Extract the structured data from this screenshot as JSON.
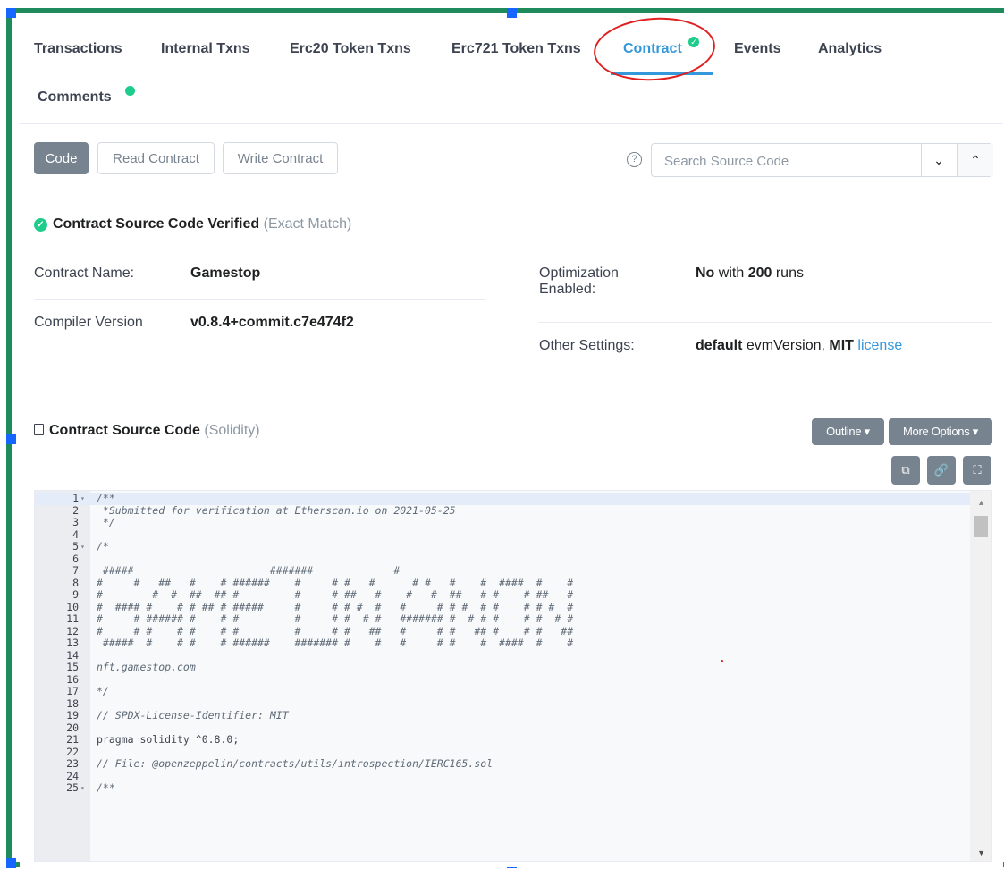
{
  "tabs": [
    {
      "label": "Transactions"
    },
    {
      "label": "Internal Txns"
    },
    {
      "label": "Erc20 Token Txns"
    },
    {
      "label": "Erc721 Token Txns"
    },
    {
      "label": "Contract"
    },
    {
      "label": "Events"
    },
    {
      "label": "Analytics"
    },
    {
      "label": "Comments"
    }
  ],
  "code_tabs": {
    "code": "Code",
    "read": "Read Contract",
    "write": "Write Contract"
  },
  "search": {
    "placeholder": "Search Source Code"
  },
  "verified": {
    "title": "Contract Source Code Verified",
    "note": "(Exact Match)"
  },
  "details": {
    "contract_name_label": "Contract Name:",
    "contract_name": "Gamestop",
    "compiler_label": "Compiler Version",
    "compiler": "v0.8.4+commit.c7e474f2",
    "optimization_label_1": "Optimization",
    "optimization_label_2": "Enabled:",
    "optimization_no": "No",
    "optimization_with": "with",
    "optimization_runs": "200",
    "optimization_runs_word": "runs",
    "other_label": "Other Settings:",
    "other_default": "default",
    "other_evm": "evmVersion,",
    "other_mit": "MIT",
    "other_license": "license"
  },
  "source": {
    "title": "Contract Source Code",
    "lang": "(Solidity)",
    "outline": "Outline",
    "more": "More Options",
    "lines": [
      {
        "n": "1",
        "fold": true,
        "text": "/**",
        "c": true
      },
      {
        "n": "2",
        "text": " *Submitted for verification at Etherscan.io on 2021-05-25",
        "c": true
      },
      {
        "n": "3",
        "text": " */",
        "c": true
      },
      {
        "n": "4",
        "text": ""
      },
      {
        "n": "5",
        "fold": true,
        "text": "/*",
        "c": true
      },
      {
        "n": "6",
        "text": ""
      },
      {
        "n": "7",
        "text": " #####                      #######             #",
        "c": true
      },
      {
        "n": "8",
        "text": "#     #   ##   #    # ######    #     # #   #      # #   #    #  ####  #    #",
        "c": true
      },
      {
        "n": "9",
        "text": "#        #  #  ##  ## #         #     # ##   #    #   #  ##   # #    # ##   #",
        "c": true
      },
      {
        "n": "10",
        "text": "#  #### #    # # ## # #####     #     # # #  #   #     # # #  # #    # # #  #",
        "c": true
      },
      {
        "n": "11",
        "text": "#     # ###### #    # #         #     # #  # #   ####### #  # # #    # #  # #",
        "c": true
      },
      {
        "n": "12",
        "text": "#     # #    # #    # #         #     # #   ##   #     # #   ## #    # #   ##",
        "c": true
      },
      {
        "n": "13",
        "text": " #####  #    # #    # ######    ####### #    #   #     # #    #  ####  #    #",
        "c": true
      },
      {
        "n": "14",
        "text": ""
      },
      {
        "n": "15",
        "text": "nft.gamestop.com",
        "c": true
      },
      {
        "n": "16",
        "text": ""
      },
      {
        "n": "17",
        "text": "*/",
        "c": true
      },
      {
        "n": "18",
        "text": ""
      },
      {
        "n": "19",
        "text": "// SPDX-License-Identifier: MIT",
        "c": true
      },
      {
        "n": "20",
        "text": ""
      },
      {
        "n": "21",
        "text": "pragma solidity ^0.8.0;"
      },
      {
        "n": "22",
        "text": ""
      },
      {
        "n": "23",
        "text": "// File: @openzeppelin/contracts/utils/introspection/IERC165.sol",
        "c": true
      },
      {
        "n": "24",
        "text": ""
      },
      {
        "n": "25",
        "fold": true,
        "text": "/**",
        "c": true
      }
    ]
  }
}
